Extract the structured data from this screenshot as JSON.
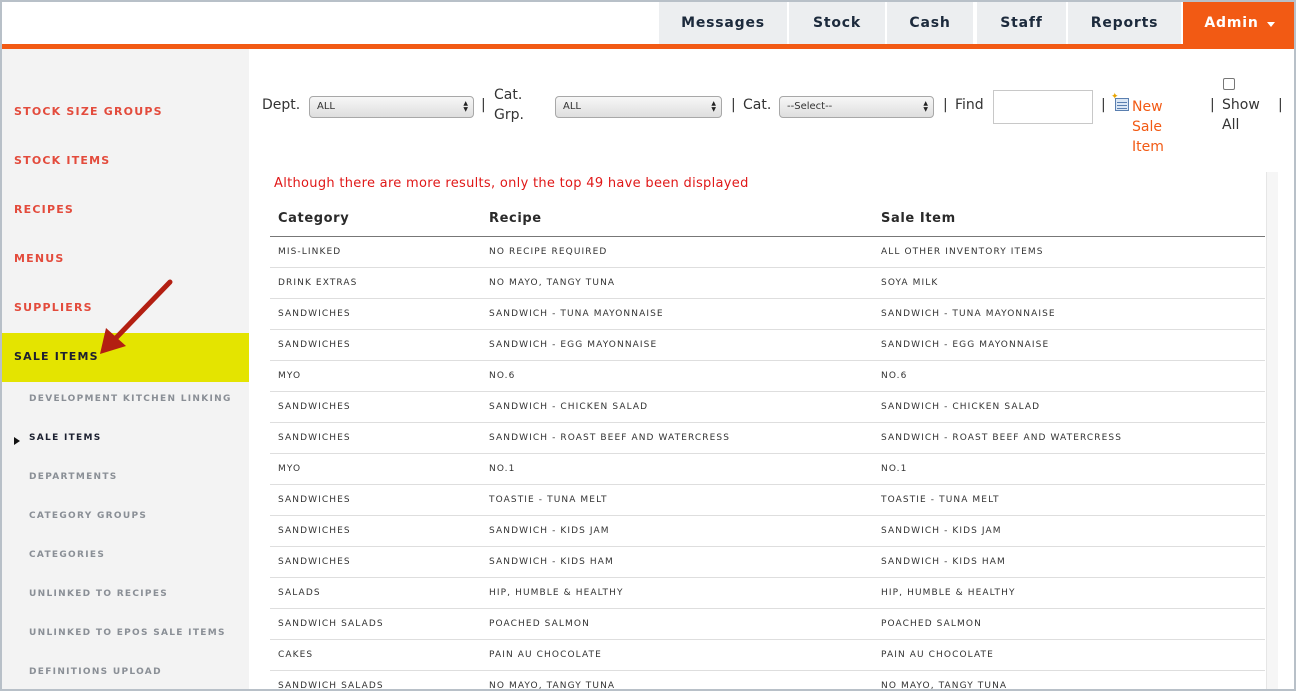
{
  "topnav": {
    "tabs": [
      "Messages",
      "Stock",
      "Cash",
      "Staff",
      "Reports"
    ],
    "admin_label": "Admin"
  },
  "sidebar": {
    "main_items": [
      "STOCK SIZE GROUPS",
      "STOCK ITEMS",
      "RECIPES",
      "MENUS",
      "SUPPLIERS"
    ],
    "active_item": "SALE ITEMS",
    "sub_items": [
      "DEVELOPMENT KITCHEN LINKING",
      "SALE ITEMS",
      "DEPARTMENTS",
      "CATEGORY GROUPS",
      "CATEGORIES",
      "UNLINKED TO RECIPES",
      "UNLINKED TO EPOS SALE ITEMS",
      "DEFINITIONS UPLOAD"
    ],
    "current_sub": "SALE ITEMS"
  },
  "filters": {
    "dept_label": "Dept.",
    "dept_value": "ALL",
    "catgrp_label_line1": "Cat.",
    "catgrp_label_line2": "Grp.",
    "catgrp_value": "ALL",
    "cat_label": "Cat.",
    "cat_value": "--Select--",
    "find_label": "Find",
    "find_value": "",
    "new_sale_line1": "New",
    "new_sale_line2": "Sale",
    "new_sale_line3": "Item",
    "show_all_line1": "Show",
    "show_all_line2": "All",
    "separator": "|"
  },
  "results": {
    "notice": "Although there are more results, only the top 49 have been displayed",
    "columns": [
      "Category",
      "Recipe",
      "Sale Item"
    ],
    "rows": [
      [
        "MIS-LINKED",
        "NO RECIPE REQUIRED",
        "ALL OTHER INVENTORY ITEMS"
      ],
      [
        "DRINK EXTRAS",
        "NO MAYO, TANGY TUNA",
        "SOYA MILK"
      ],
      [
        "SANDWICHES",
        "SANDWICH - TUNA MAYONNAISE",
        "SANDWICH - TUNA MAYONNAISE"
      ],
      [
        "SANDWICHES",
        "SANDWICH - EGG MAYONNAISE",
        "SANDWICH - EGG MAYONNAISE"
      ],
      [
        "MYO",
        "NO.6",
        "NO.6"
      ],
      [
        "SANDWICHES",
        "SANDWICH - CHICKEN SALAD",
        "SANDWICH - CHICKEN SALAD"
      ],
      [
        "SANDWICHES",
        "SANDWICH - ROAST BEEF AND WATERCRESS",
        "SANDWICH - ROAST BEEF AND WATERCRESS"
      ],
      [
        "MYO",
        "NO.1",
        "NO.1"
      ],
      [
        "SANDWICHES",
        "TOASTIE - TUNA MELT",
        "TOASTIE - TUNA MELT"
      ],
      [
        "SANDWICHES",
        "SANDWICH - KIDS JAM",
        "SANDWICH - KIDS JAM"
      ],
      [
        "SANDWICHES",
        "SANDWICH - KIDS HAM",
        "SANDWICH - KIDS HAM"
      ],
      [
        "SALADS",
        "HIP, HUMBLE & HEALTHY",
        "HIP, HUMBLE & HEALTHY"
      ],
      [
        "SANDWICH SALADS",
        "POACHED SALMON",
        "POACHED SALMON"
      ],
      [
        "CAKES",
        "PAIN AU CHOCOLATE",
        "PAIN AU CHOCOLATE"
      ],
      [
        "SANDWICH SALADS",
        "NO MAYO, TANGY TUNA",
        "NO MAYO, TANGY TUNA"
      ]
    ]
  },
  "colors": {
    "accent": "#f25a14",
    "highlight": "#e4e400",
    "sidebar_link": "#e34b3c",
    "notice": "#e01818",
    "annotation_arrow": "#b31f12"
  }
}
